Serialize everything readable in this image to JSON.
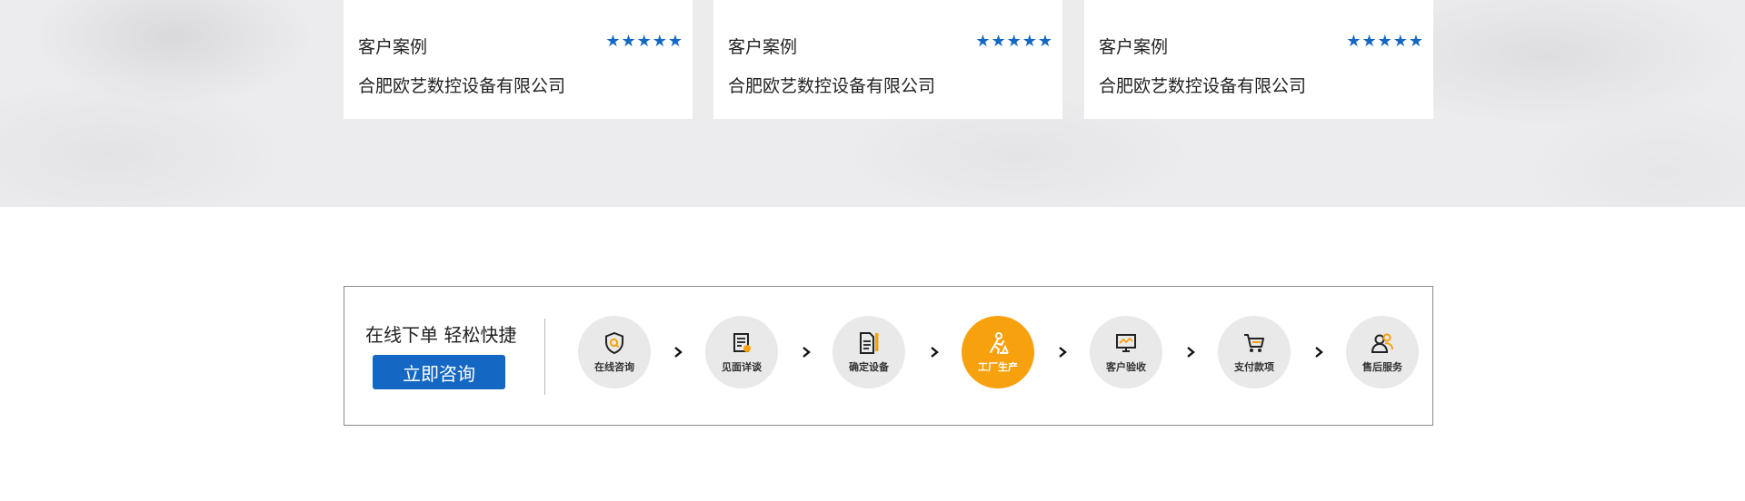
{
  "cases": [
    {
      "tag": "客户案例",
      "stars": "★★★★★",
      "company": "合肥欧艺数控设备有限公司"
    },
    {
      "tag": "客户案例",
      "stars": "★★★★★",
      "company": "合肥欧艺数控设备有限公司"
    },
    {
      "tag": "客户案例",
      "stars": "★★★★★",
      "company": "合肥欧艺数控设备有限公司"
    }
  ],
  "rating": {
    "value": 5,
    "max": 5,
    "star_color": "#1468c4"
  },
  "order": {
    "title": "在线下单 轻松快捷",
    "button_label": "立即咨询"
  },
  "steps": [
    {
      "label": "在线咨询",
      "icon": "shield-search-icon",
      "active": false
    },
    {
      "label": "见面详谈",
      "icon": "document-check-icon",
      "active": false
    },
    {
      "label": "确定设备",
      "icon": "document-pencil-icon",
      "active": false
    },
    {
      "label": "工厂生产",
      "icon": "worker-icon",
      "active": true
    },
    {
      "label": "客户验收",
      "icon": "monitor-icon",
      "active": false
    },
    {
      "label": "支付款项",
      "icon": "cart-icon",
      "active": false
    },
    {
      "label": "售后服务",
      "icon": "customer-service-icon",
      "active": false
    }
  ],
  "colors": {
    "brand_blue": "#1468c4",
    "active_orange": "#f7a10f",
    "step_bg": "#e9e9e9"
  }
}
